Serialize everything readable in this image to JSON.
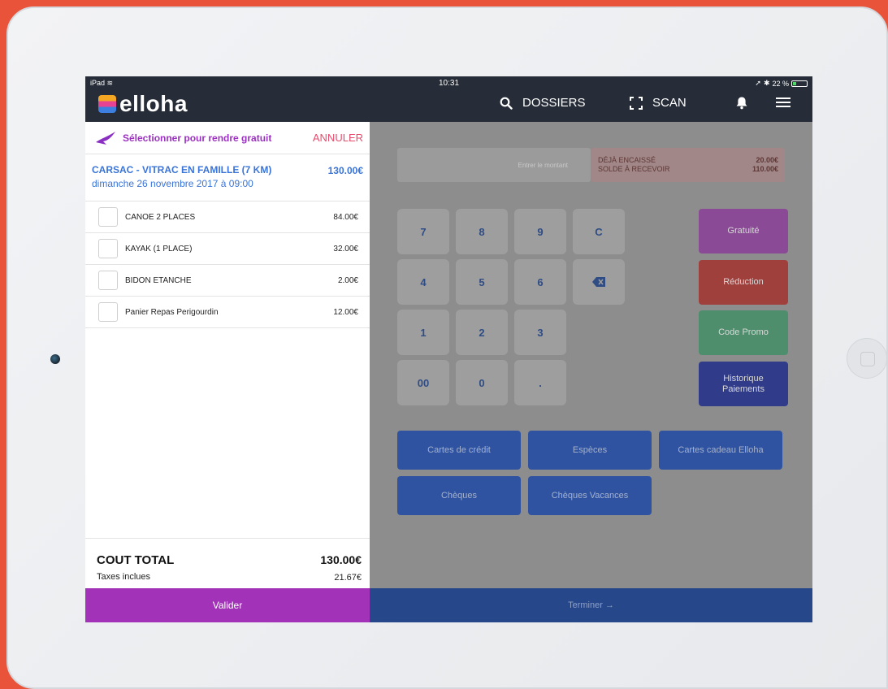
{
  "status": {
    "device": "iPad",
    "time": "10:31",
    "battery": "22 %"
  },
  "app": {
    "name": "elloha"
  },
  "nav": {
    "dossiers": "DOSSIERS",
    "scan": "SCAN"
  },
  "selection": {
    "label": "Sélectionner pour rendre gratuit",
    "cancel": "ANNULER"
  },
  "booking": {
    "name": "CARSAC - VITRAC EN FAMILLE (7 KM)",
    "price": "130.00€",
    "date": "dimanche 26 novembre 2017 à 09:00"
  },
  "items": [
    {
      "name": "CANOE 2 PLACES",
      "price": "84.00€"
    },
    {
      "name": "KAYAK (1 PLACE)",
      "price": "32.00€"
    },
    {
      "name": "BIDON ETANCHE",
      "price": "2.00€"
    },
    {
      "name": "Panier Repas Perigourdin",
      "price": "12.00€"
    }
  ],
  "totals": {
    "label": "COUT TOTAL",
    "value": "130.00€",
    "tax_label": "Taxes inclues",
    "tax_value": "21.67€"
  },
  "valider_label": "Valider",
  "payment": {
    "amount_placeholder": "Entrer le montant",
    "already_label": "DÉJÀ ENCAISSÉ",
    "already_value": "20.00€",
    "balance_label": "SOLDE À RECEVOIR",
    "balance_value": "110.00€"
  },
  "keypad": [
    "7",
    "8",
    "9",
    "C",
    "4",
    "5",
    "6",
    "1",
    "2",
    "3",
    "00",
    "0",
    "."
  ],
  "side_buttons": {
    "gratuite": "Gratuité",
    "reduction": "Réduction",
    "promo": "Code Promo",
    "history_1": "Historique",
    "history_2": "Paiements"
  },
  "pay_methods": {
    "cartes": "Cartes de crédit",
    "especes": "Espèces",
    "cadeau": "Cartes cadeau Elloha",
    "cheques": "Chèques",
    "vacances": "Chèques Vacances"
  },
  "terminer_label": "Terminer →",
  "colors": {
    "accent_purple": "#a233b8",
    "link_blue": "#3a74d8",
    "cancel_pink": "#e74c6e",
    "navbar": "#262d38",
    "gratuite": "#8a4a96",
    "reduction": "#a0403d",
    "promo": "#4f8e6d",
    "history": "#303c8a"
  }
}
